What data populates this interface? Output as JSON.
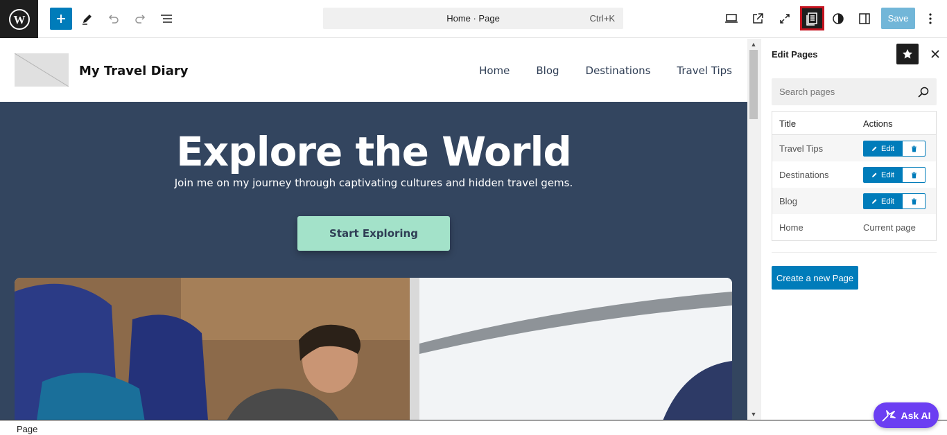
{
  "toolbar": {
    "command_title": "Home · Page",
    "command_shortcut": "Ctrl+K",
    "save_label": "Save"
  },
  "site": {
    "title": "My Travel Diary",
    "nav": [
      "Home",
      "Blog",
      "Destinations",
      "Travel Tips"
    ]
  },
  "hero": {
    "title": "Explore the World",
    "subtitle": "Join me on my journey through captivating cultures and hidden travel gems.",
    "cta_label": "Start Exploring"
  },
  "sidebar": {
    "title": "Edit Pages",
    "search_placeholder": "Search pages",
    "columns": {
      "title": "Title",
      "actions": "Actions"
    },
    "rows": [
      {
        "title": "Travel Tips",
        "edit_label": "Edit"
      },
      {
        "title": "Destinations",
        "edit_label": "Edit"
      },
      {
        "title": "Blog",
        "edit_label": "Edit"
      },
      {
        "title": "Home",
        "status": "Current page"
      }
    ],
    "new_page_label": "Create a new Page"
  },
  "footer": {
    "breadcrumb": "Page"
  },
  "ask_ai_label": "Ask AI",
  "colors": {
    "accent": "#007cba",
    "hero_bg": "#33455f",
    "cta": "#a3e2c9",
    "ask_ai": "#6b3ef2"
  }
}
